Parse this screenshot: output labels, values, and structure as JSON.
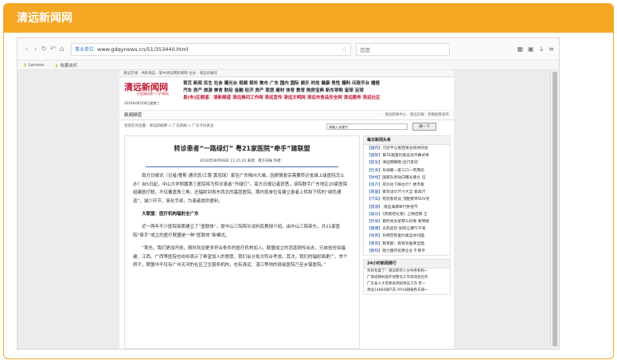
{
  "card": {
    "title": "清远新闻网"
  },
  "browser": {
    "secure_label": "事业单位",
    "url": "www.gdqynews.cn/51/353440.html",
    "search_placeholder": "百度",
    "bookmarks": [
      "Lenovo",
      "收藏夹栏"
    ]
  },
  "site": {
    "topbar": "清远在线 · 书杂清远 · 掌中清远网新闻网    主办：清远日报社",
    "logo": "清远新闻网",
    "logo_sub": "打造清远第一门户网站",
    "date": "2016年06月08日星期三",
    "nav_lines": [
      "首页  新闻  民生  社会  曝光台  视频  视听   焦市  广东  国内  国际   娱乐  时尚  健康  男性   爆料  问政平台  播报",
      "汽车  房产  旅游  美食   财经  金融  经济  房产  家居  建材   体育   教育   购房宝典   新车导购   留球   足球",
      "县(市)区频道：清新频道   清远佛冈工作网   清远宣传   清远文明网   清远市食品安全网   清远服务   清远社区"
    ],
    "channel_label": "新闻频道",
    "channel_right": "· 清远新闻中心 · 清远日报 · 多数据库发布",
    "crumb": "您现在的位置：清远新闻网 > 广东新闻 > 广东今日关注",
    "search_placeholder": "请输入关键字",
    "search_btn": "搜一下"
  },
  "article": {
    "title": "转诊患者“一路绿灯” 粤21家医院“牵手”建联盟",
    "meta": "2016年06月08日 11:35:20   来源：南方日报    作者：",
    "paragraphs": [
      "南方日报讯（记者/曹斯 通讯员/江蕾 黄冠球）家住广东梅州大埔，因病情复杂需要转诊省城上级医院怎么办？自5日起，中山大学附属第三医院将为转诊患者“开绿灯”。南方日报记者获悉，该院联手广东地区20家医院组建医疗联，不仅覆盖珠三角，还辐射到粤东西北的基层医院，期内现单位有建立患者上转和下转的“绿色通道”，减少环节，简化手续，为患者提供便利。",
      "大联盟：医疗机构辐射全广东",
      "近一两年不少医院探索建立了“医联体”，提中山三院院长戎利民教授介绍，由中山三院牵头，共21家医院“牵手”成立的医疗联盟是一种“医联体”新模式。",
      "“首先，我们更加开放，随时欢迎更多符合条件的医疗机构加入。联盟成立的消息刚传出去，兄弟省份如福建、江西、广西等医院也纷纷表示了希望加入的意愿，我们会分批次符合考虑。其次，我们的辐射面更广，举个例子，联盟中不仅有广州天河的社区卫生服务机构，也有清远、湛江等地的县级医院乃至乡镇医院。”"
    ]
  },
  "sidebar": {
    "daily_title": "每日新闻头条",
    "daily_items": [
      {
        "tag": "【国内】",
        "text": "习近平与墨西哥总统共同会"
      },
      {
        "tag": "【国际】",
        "text": "第31届里约奥运会开幕式举"
      },
      {
        "tag": "【民生】",
        "text": "清远明细街:出行友好"
      },
      {
        "tag": "【社会】",
        "text": "车祸路一家三口一死两伤"
      },
      {
        "tag": "【财经】",
        "text": "国家队新动向曝光重仓 证"
      },
      {
        "tag": "【房产】",
        "text": "房价往下降也行？楼市看"
      },
      {
        "tag": "【家居】",
        "text": "家装设计尺寸大全 家具尺"
      },
      {
        "tag": "【汽车】",
        "text": "有前有的设 顶配携带SUV买"
      },
      {
        "tag": "【旅游】",
        "text": "  清远海潮举行民俗节"
      },
      {
        "tag": "【娱乐】",
        "text": "《奔跑吧兄弟》上映结算 王"
      },
      {
        "tag": "【时尚】",
        "text": "看时尚女星那么好看 看明星"
      },
      {
        "tag": "【健康】",
        "text": "天热后热 如何让爆气不来"
      },
      {
        "tag": "【体育】",
        "text": "孙杨告别里约奥运会归国"
      },
      {
        "tag": "【教育】",
        "text": "教育部：教育装备要全面"
      },
      {
        "tag": "【数码】",
        "text": "助力国内优质企业 8 携手"
      }
    ],
    "hot_title": "24小时新闻排行",
    "hot_items": [
      "有民有喜了！清远新的人分共各机构一",
      "广南城镇村居环境整治工作现场会召开",
      "广东省人大常委会调研清远工作 曾一",
      "清远14884辆汽车 6918辆载各车辆一"
    ]
  }
}
